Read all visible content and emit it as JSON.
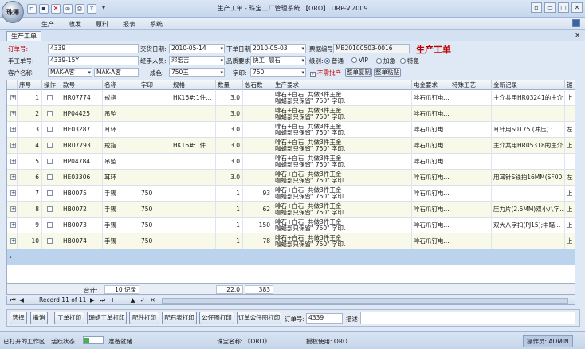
{
  "window": {
    "title": "生产工单 - 珠宝工厂管理系统 【ORO】 URP-V.2009",
    "logo_text": "珠澤"
  },
  "menu": [
    "生产",
    "收发",
    "原料",
    "报表",
    "系统"
  ],
  "tab": {
    "label": "生产工单"
  },
  "form": {
    "title": "生产工单",
    "order_no_label": "订单号:",
    "order_no": "4339",
    "delivery_date_label": "交货日期:",
    "delivery_date": "2010-05-14",
    "issue_date_label": "下单日期:",
    "issue_date": "2010-05-03",
    "ticket_no_label": "票据编号:",
    "ticket_no": "MB20100503-0016",
    "manual_no_label": "手工单号:",
    "manual_no": "4339-15Y",
    "handler_label": "经手人员:",
    "handler": "邓宏吉",
    "quality_label": "品质要求:",
    "quality": "快工",
    "quality2": "靓石",
    "level_label": "级别:",
    "levels": [
      {
        "label": "普通",
        "checked": true
      },
      {
        "label": "VIP",
        "checked": false
      },
      {
        "label": "加急",
        "checked": false
      },
      {
        "label": "特急",
        "checked": false
      }
    ],
    "customer_label": "客户名称:",
    "customer_code": "MAK-A客",
    "customer_name": "MAK-A客",
    "color_label": "成色:",
    "color": "750王",
    "stamp_label": "字印:",
    "stamp": "750",
    "no_batch_label": "不需批产",
    "copy_btn": "整单复制",
    "paste_btn": "整单粘贴"
  },
  "grid": {
    "columns": [
      "",
      "序号",
      "操作",
      "款号",
      "名称",
      "字印",
      "规格",
      "数量",
      "总石数",
      "生产要求",
      "电金要求",
      "特殊工艺",
      "金新记录",
      "镀"
    ],
    "rows": [
      {
        "seq": "1",
        "code": "HR07774",
        "name": "戒指",
        "stamp": "",
        "spec": "HK16#:1件...",
        "qty": "3.0",
        "stones": "",
        "req": "啡石+白石  共做3件王金\n咖蜡部只保留\" 750\" 字印.",
        "plating": "啡石爪钉电...",
        "craft": "",
        "record": "主介共用HR03241的主介",
        "extra": "上"
      },
      {
        "seq": "2",
        "code": "HP04425",
        "name": "吊坠",
        "stamp": "",
        "spec": "",
        "qty": "3.0",
        "stones": "",
        "req": "啡石+白石  共做3件王金\n咖蜡部只保留\" 750\" 字印.",
        "plating": "啡石爪钉电...",
        "craft": "",
        "record": "",
        "extra": ""
      },
      {
        "seq": "3",
        "code": "HE03287",
        "name": "耳环",
        "stamp": "",
        "spec": "",
        "qty": "3.0",
        "stones": "",
        "req": "啡石+白石  共做3件王金\n咖蜡部只保留\" 750\" 字印.",
        "plating": "啡石爪钉电...",
        "craft": "",
        "record": "耳针用S0175 (冲压) :",
        "extra": "左"
      },
      {
        "seq": "4",
        "code": "HR07793",
        "name": "戒指",
        "stamp": "",
        "spec": "HK16#:1件...",
        "qty": "3.0",
        "stones": "",
        "req": "啡石+白石  共做3件王金\n咖蜡部只保留\" 750\" 字印.",
        "plating": "啡石爪钉电...",
        "craft": "",
        "record": "主介共用HR05318的主介",
        "extra": "上"
      },
      {
        "seq": "5",
        "code": "HP04784",
        "name": "吊坠",
        "stamp": "",
        "spec": "",
        "qty": "3.0",
        "stones": "",
        "req": "啡石+白石  共做3件王金\n咖蜡部只保留\" 750\" 字印.",
        "plating": "啡石爪钉电...",
        "craft": "",
        "record": "",
        "extra": ""
      },
      {
        "seq": "6",
        "code": "HE03306",
        "name": "耳环",
        "stamp": "",
        "spec": "",
        "qty": "3.0",
        "stones": "",
        "req": "啡石+白石  共做3件王金\n咖蜡部只保留\" 750\" 字印.",
        "plating": "啡石爪钉电...",
        "craft": "",
        "record": "用耳针S钱拍16MM(SF00...",
        "extra": "左"
      },
      {
        "seq": "7",
        "code": "HB0075",
        "name": "手镯",
        "stamp": "750",
        "spec": "",
        "qty": "1",
        "stones": "93",
        "req": "啡石+白石  共做3件王金\n咖蜡部只保留\" 750\" 字印.",
        "plating": "啡石爪钉电...",
        "craft": "",
        "record": "",
        "extra": "上"
      },
      {
        "seq": "8",
        "code": "HB0072",
        "name": "手镯",
        "stamp": "750",
        "spec": "",
        "qty": "1",
        "stones": "62",
        "req": "啡石+白石  共做3件王金\n咖蜡部只保留\" 750\" 字印.",
        "plating": "啡石爪钉电...",
        "craft": "",
        "record": "压力片(2.5MM)双小八字...",
        "extra": "上"
      },
      {
        "seq": "9",
        "code": "HB0073",
        "name": "手镯",
        "stamp": "750",
        "spec": "",
        "qty": "1",
        "stones": "150",
        "req": "啡石+白石  共做3件王金\n咖蜡部只保留\" 750\" 字印.",
        "plating": "啡石爪钉电...",
        "craft": "",
        "record": "双大八字扣(PJ15);中瞄...",
        "extra": "上"
      },
      {
        "seq": "10",
        "code": "HB0074",
        "name": "手镯",
        "stamp": "750",
        "spec": "",
        "qty": "1",
        "stones": "78",
        "req": "啡石+白石  共做3件王金\n咖蜡部只保留\" 750\" 字印.",
        "plating": "啡石爪钉电...",
        "craft": "",
        "record": "",
        "extra": "上"
      }
    ]
  },
  "footer": {
    "total_label": "合计:",
    "record_count": "10 记录",
    "qty_total": "22.0",
    "stones_total": "383"
  },
  "navigator": {
    "text": "Record 11 of 11"
  },
  "actions": {
    "buttons": [
      "选择",
      "撤消",
      "工单打印",
      "珊蜡工单打印",
      "配件打印",
      "配石表打印",
      "公仔图打印",
      "订单公仔图打印"
    ],
    "order_no_label": "订单号:",
    "order_no": "4339",
    "desc_label": "描述:",
    "desc": ""
  },
  "status": {
    "opened_label": "已打开的工作区",
    "activity_label": "活跃状态",
    "ready": "准备就绪",
    "company": "珠宝名称: 《ORO》",
    "license": "授权使用: ORO",
    "operator": "操作员: ADMIN"
  }
}
